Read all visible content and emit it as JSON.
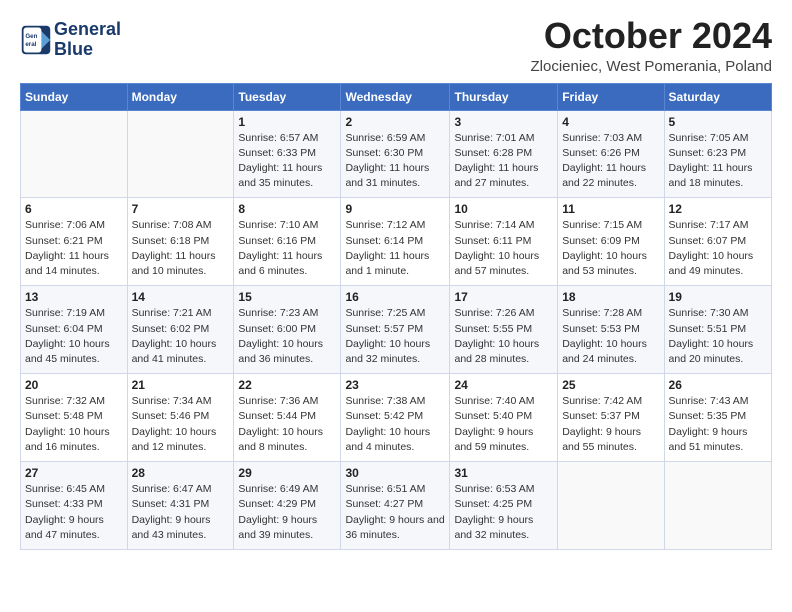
{
  "header": {
    "logo_line1": "General",
    "logo_line2": "Blue",
    "month": "October 2024",
    "location": "Zlocieniec, West Pomerania, Poland"
  },
  "days_of_week": [
    "Sunday",
    "Monday",
    "Tuesday",
    "Wednesday",
    "Thursday",
    "Friday",
    "Saturday"
  ],
  "weeks": [
    [
      {
        "day": null
      },
      {
        "day": null
      },
      {
        "day": 1,
        "sunrise": "6:57 AM",
        "sunset": "6:33 PM",
        "daylight": "11 hours and 35 minutes."
      },
      {
        "day": 2,
        "sunrise": "6:59 AM",
        "sunset": "6:30 PM",
        "daylight": "11 hours and 31 minutes."
      },
      {
        "day": 3,
        "sunrise": "7:01 AM",
        "sunset": "6:28 PM",
        "daylight": "11 hours and 27 minutes."
      },
      {
        "day": 4,
        "sunrise": "7:03 AM",
        "sunset": "6:26 PM",
        "daylight": "11 hours and 22 minutes."
      },
      {
        "day": 5,
        "sunrise": "7:05 AM",
        "sunset": "6:23 PM",
        "daylight": "11 hours and 18 minutes."
      }
    ],
    [
      {
        "day": 6,
        "sunrise": "7:06 AM",
        "sunset": "6:21 PM",
        "daylight": "11 hours and 14 minutes."
      },
      {
        "day": 7,
        "sunrise": "7:08 AM",
        "sunset": "6:18 PM",
        "daylight": "11 hours and 10 minutes."
      },
      {
        "day": 8,
        "sunrise": "7:10 AM",
        "sunset": "6:16 PM",
        "daylight": "11 hours and 6 minutes."
      },
      {
        "day": 9,
        "sunrise": "7:12 AM",
        "sunset": "6:14 PM",
        "daylight": "11 hours and 1 minute."
      },
      {
        "day": 10,
        "sunrise": "7:14 AM",
        "sunset": "6:11 PM",
        "daylight": "10 hours and 57 minutes."
      },
      {
        "day": 11,
        "sunrise": "7:15 AM",
        "sunset": "6:09 PM",
        "daylight": "10 hours and 53 minutes."
      },
      {
        "day": 12,
        "sunrise": "7:17 AM",
        "sunset": "6:07 PM",
        "daylight": "10 hours and 49 minutes."
      }
    ],
    [
      {
        "day": 13,
        "sunrise": "7:19 AM",
        "sunset": "6:04 PM",
        "daylight": "10 hours and 45 minutes."
      },
      {
        "day": 14,
        "sunrise": "7:21 AM",
        "sunset": "6:02 PM",
        "daylight": "10 hours and 41 minutes."
      },
      {
        "day": 15,
        "sunrise": "7:23 AM",
        "sunset": "6:00 PM",
        "daylight": "10 hours and 36 minutes."
      },
      {
        "day": 16,
        "sunrise": "7:25 AM",
        "sunset": "5:57 PM",
        "daylight": "10 hours and 32 minutes."
      },
      {
        "day": 17,
        "sunrise": "7:26 AM",
        "sunset": "5:55 PM",
        "daylight": "10 hours and 28 minutes."
      },
      {
        "day": 18,
        "sunrise": "7:28 AM",
        "sunset": "5:53 PM",
        "daylight": "10 hours and 24 minutes."
      },
      {
        "day": 19,
        "sunrise": "7:30 AM",
        "sunset": "5:51 PM",
        "daylight": "10 hours and 20 minutes."
      }
    ],
    [
      {
        "day": 20,
        "sunrise": "7:32 AM",
        "sunset": "5:48 PM",
        "daylight": "10 hours and 16 minutes."
      },
      {
        "day": 21,
        "sunrise": "7:34 AM",
        "sunset": "5:46 PM",
        "daylight": "10 hours and 12 minutes."
      },
      {
        "day": 22,
        "sunrise": "7:36 AM",
        "sunset": "5:44 PM",
        "daylight": "10 hours and 8 minutes."
      },
      {
        "day": 23,
        "sunrise": "7:38 AM",
        "sunset": "5:42 PM",
        "daylight": "10 hours and 4 minutes."
      },
      {
        "day": 24,
        "sunrise": "7:40 AM",
        "sunset": "5:40 PM",
        "daylight": "9 hours and 59 minutes."
      },
      {
        "day": 25,
        "sunrise": "7:42 AM",
        "sunset": "5:37 PM",
        "daylight": "9 hours and 55 minutes."
      },
      {
        "day": 26,
        "sunrise": "7:43 AM",
        "sunset": "5:35 PM",
        "daylight": "9 hours and 51 minutes."
      }
    ],
    [
      {
        "day": 27,
        "sunrise": "6:45 AM",
        "sunset": "4:33 PM",
        "daylight": "9 hours and 47 minutes."
      },
      {
        "day": 28,
        "sunrise": "6:47 AM",
        "sunset": "4:31 PM",
        "daylight": "9 hours and 43 minutes."
      },
      {
        "day": 29,
        "sunrise": "6:49 AM",
        "sunset": "4:29 PM",
        "daylight": "9 hours and 39 minutes."
      },
      {
        "day": 30,
        "sunrise": "6:51 AM",
        "sunset": "4:27 PM",
        "daylight": "9 hours and 36 minutes."
      },
      {
        "day": 31,
        "sunrise": "6:53 AM",
        "sunset": "4:25 PM",
        "daylight": "9 hours and 32 minutes."
      },
      {
        "day": null
      },
      {
        "day": null
      }
    ]
  ]
}
